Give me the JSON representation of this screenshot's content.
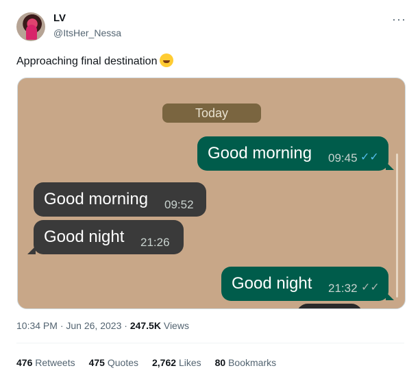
{
  "author": {
    "name": "LV",
    "handle": "@ItsHer_Nessa"
  },
  "more_label": "···",
  "tweet_text": "Approaching final destination",
  "emoji_icon": "rolling-on-floor-laughing-emoji",
  "media": {
    "background_color": "#c8a788",
    "day_label": "Today",
    "messages": [
      {
        "direction": "outgoing",
        "text": "Good morning",
        "time": "09:45",
        "status": "read-double-check"
      },
      {
        "direction": "incoming",
        "text": "Good morning",
        "time": "09:52"
      },
      {
        "direction": "incoming",
        "text": "Good night",
        "time": "21:26"
      },
      {
        "direction": "outgoing",
        "text": "Good night",
        "time": "21:32",
        "status": "delivered-double-check"
      }
    ]
  },
  "meta": {
    "time": "10:34 PM",
    "date": "Jun 26, 2023",
    "views_count": "247.5K",
    "views_label": "Views",
    "separator": "·"
  },
  "stats": [
    {
      "count": "476",
      "label": "Retweets"
    },
    {
      "count": "475",
      "label": "Quotes"
    },
    {
      "count": "2,762",
      "label": "Likes"
    },
    {
      "count": "80",
      "label": "Bookmarks"
    }
  ]
}
